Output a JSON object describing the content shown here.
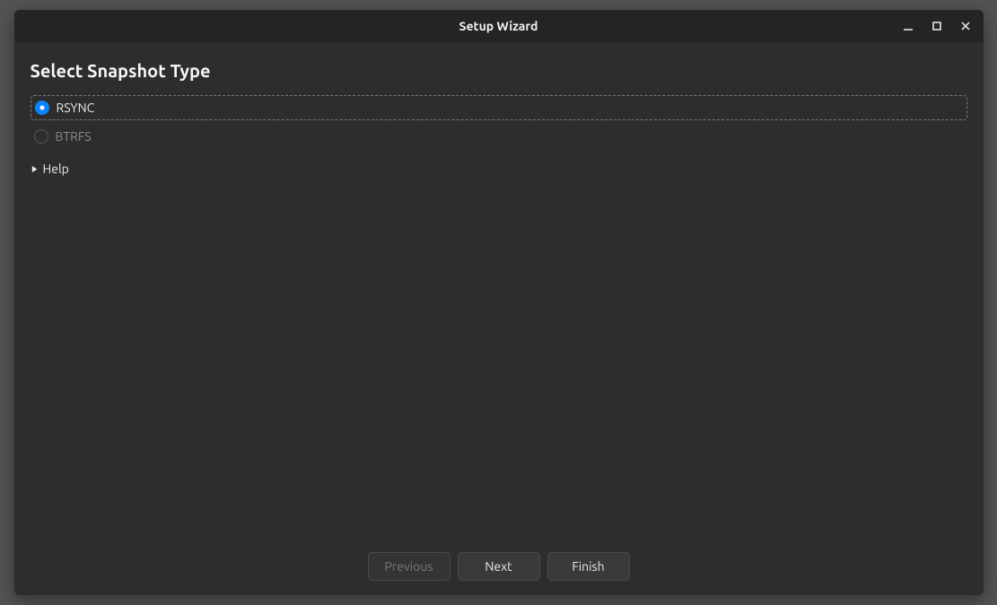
{
  "window": {
    "title": "Setup Wizard"
  },
  "page": {
    "heading": "Select Snapshot Type",
    "options": {
      "rsync": {
        "label": "RSYNC",
        "selected": true,
        "enabled": true
      },
      "btrfs": {
        "label": "BTRFS",
        "selected": false,
        "enabled": false
      }
    },
    "help": {
      "label": "Help",
      "expanded": false
    }
  },
  "footer": {
    "previous": {
      "label": "Previous",
      "enabled": false
    },
    "next": {
      "label": "Next",
      "enabled": true
    },
    "finish": {
      "label": "Finish",
      "enabled": true
    }
  }
}
